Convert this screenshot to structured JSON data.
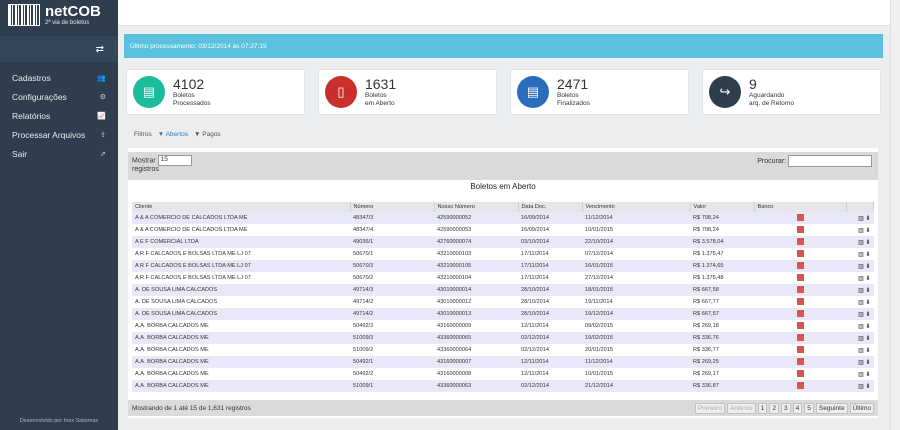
{
  "sidebar": {
    "logo_main": "netCOB",
    "logo_sub": "2ª via de boletos",
    "items": [
      {
        "label": "Cadastros",
        "icon": "users-icon"
      },
      {
        "label": "Configurações",
        "icon": "gears-icon"
      },
      {
        "label": "Relatórios",
        "icon": "chart-icon"
      },
      {
        "label": "Processar Arquivos",
        "icon": "upload-icon"
      },
      {
        "label": "Sair",
        "icon": "external-link-icon"
      }
    ],
    "footer": "Desenvolvido por Inex Sistemas"
  },
  "info": "Último processamento: 03/12/2014 às 07:27:15",
  "stats": [
    {
      "num": "4102",
      "l1": "Boletos",
      "l2": "Processados",
      "color": "#1abc9c"
    },
    {
      "num": "1631",
      "l1": "Boletos",
      "l2": "em Aberto",
      "color": "#c9302c"
    },
    {
      "num": "2471",
      "l1": "Boletos",
      "l2": "Finalizados",
      "color": "#2a6ebb"
    },
    {
      "num": "9",
      "l1": "Aguardando",
      "l2": "arq. de Retorno",
      "color": "#2f3e4e"
    }
  ],
  "tabs": {
    "f": "Filtros",
    "a": "Abertos",
    "p": "Pagos"
  },
  "table": {
    "mostrar": "Mostrar",
    "mostrar_val": "15",
    "registros": "registros",
    "procurar": "Procurar:",
    "title": "Boletos em Aberto",
    "headers": [
      "Cliente",
      "Número",
      "Nosso Número",
      "Data Doc.",
      "Vencimento",
      "Valor",
      "Banco"
    ],
    "rows": [
      [
        "A & A COMERCIO DE CALCADOS LTDA ME",
        "48347/3",
        "42590000052",
        "16/09/2014",
        "11/12/2014",
        "R$ 708,24"
      ],
      [
        "A & A COMERCIO DE CALCADOS LTDA ME",
        "48347/4",
        "42590000053",
        "16/09/2014",
        "10/01/2015",
        "R$ 708,24"
      ],
      [
        "A E F COMERCIAL LTDA",
        "49036/1",
        "42760000074",
        "03/10/2014",
        "22/10/2014",
        "R$ 3.578,04"
      ],
      [
        "A R F CALCADOS E BOLSAS LTDA ME LJ 07",
        "50670/1",
        "43210000103",
        "17/11/2014",
        "07/12/2014",
        "R$ 1.375,47"
      ],
      [
        "A R F CALCADOS E BOLSAS LTDA ME LJ 07",
        "50670/3",
        "43210000105",
        "17/11/2014",
        "16/01/2015",
        "R$ 1.374,65"
      ],
      [
        "A R F CALCADOS E BOLSAS LTDA ME LJ 07",
        "50670/2",
        "43210000104",
        "17/11/2014",
        "27/12/2014",
        "R$ 1.375,48"
      ],
      [
        "A. DE SOUSA LIMA CALCADOS",
        "49714/3",
        "43010000014",
        "28/10/2014",
        "18/01/2015",
        "R$ 667,58"
      ],
      [
        "A. DE SOUSA LIMA CALCADOS",
        "49714/2",
        "43010000012",
        "28/10/2014",
        "19/11/2014",
        "R$ 667,77"
      ],
      [
        "A. DE SOUSA LIMA CALCADOS",
        "49714/2",
        "43010000013",
        "28/10/2014",
        "19/12/2014",
        "R$ 667,57"
      ],
      [
        "A.A. BORBA CALCADOS ME",
        "50492/3",
        "43160000009",
        "12/11/2014",
        "09/02/2015",
        "R$ 269,18"
      ],
      [
        "A.A. BORBA CALCADOS ME",
        "51009/3",
        "43360000065",
        "02/12/2014",
        "19/02/2015",
        "R$ 336,76"
      ],
      [
        "A.A. BORBA CALCADOS ME",
        "51009/2",
        "43360000064",
        "02/12/2014",
        "20/01/2015",
        "R$ 336,77"
      ],
      [
        "A.A. BORBA CALCADOS ME",
        "50492/1",
        "43160000007",
        "12/11/2014",
        "11/12/2014",
        "R$ 269,25"
      ],
      [
        "A.A. BORBA CALCADOS ME",
        "50492/2",
        "43160000008",
        "12/11/2014",
        "10/01/2015",
        "R$ 269,17"
      ],
      [
        "A.A. BORBA CALCADOS ME",
        "51009/1",
        "43360000063",
        "02/12/2014",
        "21/12/2014",
        "R$ 336,87"
      ]
    ],
    "footer": "Mostrando de 1 até 15 de 1,631 registros",
    "pages": [
      "Primeiro",
      "Anterior",
      "1",
      "2",
      "3",
      "4",
      "5",
      "Seguinte",
      "Último"
    ]
  }
}
